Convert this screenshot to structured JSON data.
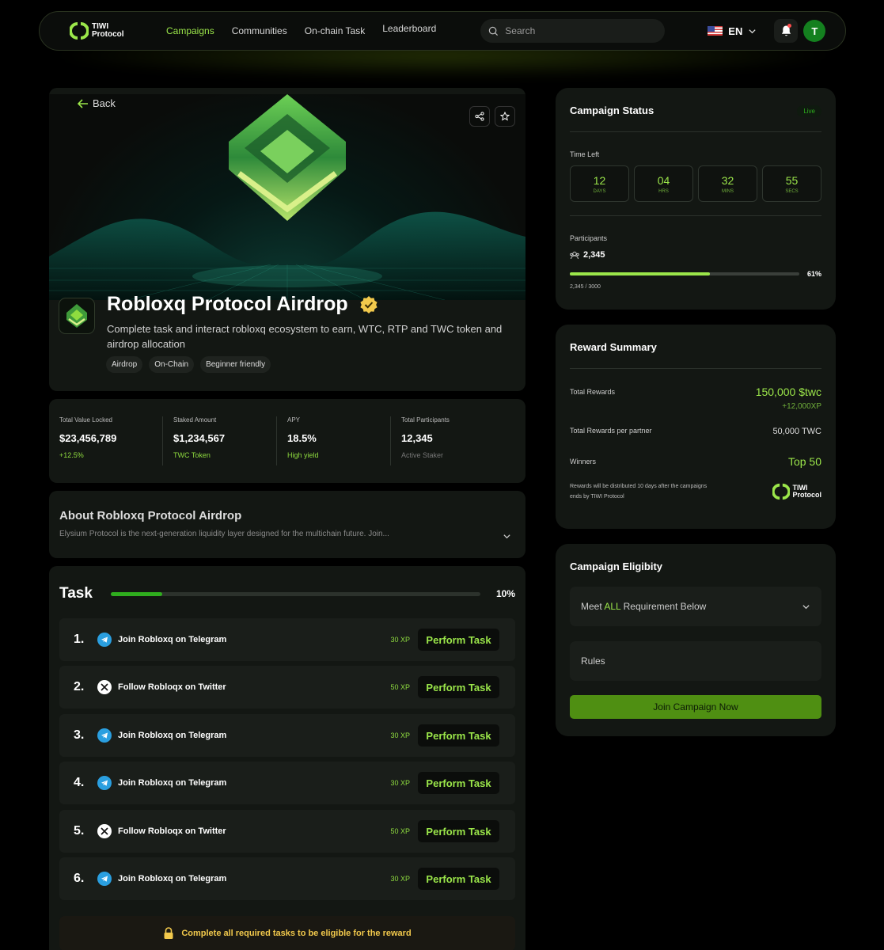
{
  "nav": {
    "logo_line1": "TIWI",
    "logo_line2": "Protocol",
    "links": [
      "Campaigns",
      "Communities",
      "On-chain Task",
      "Leaderboard"
    ],
    "search_placeholder": "Search",
    "lang": "EN",
    "avatar_initial": "T"
  },
  "hero": {
    "back_label": "Back",
    "title": "Robloxq Protocol Airdrop",
    "description": "Complete task and interact robloxq ecosystem to earn, WTC, RTP and TWC token and airdrop allocation",
    "tags": [
      "Airdrop",
      "On-Chain",
      "Beginner friendly"
    ]
  },
  "stats": [
    {
      "label": "Total Value Locked",
      "value": "$23,456,789",
      "sub": "+12.5%"
    },
    {
      "label": "Staked Amount",
      "value": "$1,234,567",
      "sub": "TWC Token"
    },
    {
      "label": "APY",
      "value": "18.5%",
      "sub": "High yield"
    },
    {
      "label": "Total Participants",
      "value": "12,345",
      "sub": "Active Staker"
    }
  ],
  "about": {
    "title": "About Robloxq Protocol Airdrop",
    "text": "Elysium Protocol is the next-generation liquidity layer designed for the multichain future. Join..."
  },
  "tasks": {
    "title": "Task",
    "progress_pct": 10,
    "progress_label": "10%",
    "button_label": "Perform Task",
    "items": [
      {
        "num": "1.",
        "icon": "telegram-icon",
        "label": "Join Robloxq on Telegram",
        "xp": "30 XP"
      },
      {
        "num": "2.",
        "icon": "x-twitter-icon",
        "label": "Follow Robloqx on Twitter",
        "xp": "50 XP"
      },
      {
        "num": "3.",
        "icon": "telegram-icon",
        "label": "Join Robloxq on Telegram",
        "xp": "30 XP"
      },
      {
        "num": "4.",
        "icon": "telegram-icon",
        "label": "Join Robloxq on Telegram",
        "xp": "30 XP"
      },
      {
        "num": "5.",
        "icon": "x-twitter-icon",
        "label": "Follow Robloqx on Twitter",
        "xp": "50 XP"
      },
      {
        "num": "6.",
        "icon": "telegram-icon",
        "label": "Join Robloxq on Telegram",
        "xp": "30 XP"
      }
    ],
    "lock_note": "Complete all required tasks to be eligible for the reward"
  },
  "status": {
    "title": "Campaign Status",
    "badge": "Live",
    "time_left_label": "Time Left",
    "timer": [
      {
        "value": "12",
        "unit": "DAYS"
      },
      {
        "value": "04",
        "unit": "HRS"
      },
      {
        "value": "32",
        "unit": "MINS"
      },
      {
        "value": "55",
        "unit": "SECS"
      }
    ],
    "participants_label": "Participants",
    "participants_count": "2,345",
    "participants_pct": 61,
    "participants_pct_label": "61%",
    "participants_caption": "2,345 / 3000"
  },
  "reward": {
    "title": "Reward Summary",
    "total_label": "Total Rewards",
    "total_value": "150,000 $twc",
    "total_xp": "+12,000XP",
    "partner_label": "Total Rewards per partner",
    "partner_value": "50,000 TWC",
    "winners_label": "Winners",
    "winners_value": "Top 50",
    "note": "Rewards will be distributed 10 days after the campaigns ends by TIWI Protocol",
    "logo_line1": "TIWI",
    "logo_line2": "Protocol"
  },
  "eligibility": {
    "title": "Campaign Eligibity",
    "select_prefix": "Meet ",
    "select_highlight": "ALL",
    "select_suffix": " Requirement Below",
    "rules_label": "Rules",
    "join_label": "Join Campaign Now"
  },
  "colors": {
    "accent": "#9be64a",
    "join_button": "#4f8f12",
    "telegram": "#2a9fe0",
    "warning": "#f2c94c"
  }
}
